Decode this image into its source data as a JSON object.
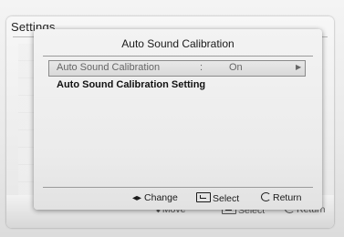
{
  "background": {
    "title": "Settings",
    "footer": {
      "move": "Move",
      "select": "Select",
      "return": "Return"
    }
  },
  "dialog": {
    "title": "Auto Sound Calibration",
    "items": [
      {
        "label": "Auto Sound Calibration",
        "separator": ":",
        "value": "On",
        "arrow_icon": "right-triangle-icon"
      },
      {
        "label": "Auto Sound Calibration Setting"
      }
    ],
    "footer": {
      "change": "Change",
      "select": "Select",
      "return": "Return"
    }
  },
  "colors": {
    "dialog_bg": "#ececec",
    "selected_row_border": "#8a8a8a",
    "text": "#1a1a1a"
  }
}
